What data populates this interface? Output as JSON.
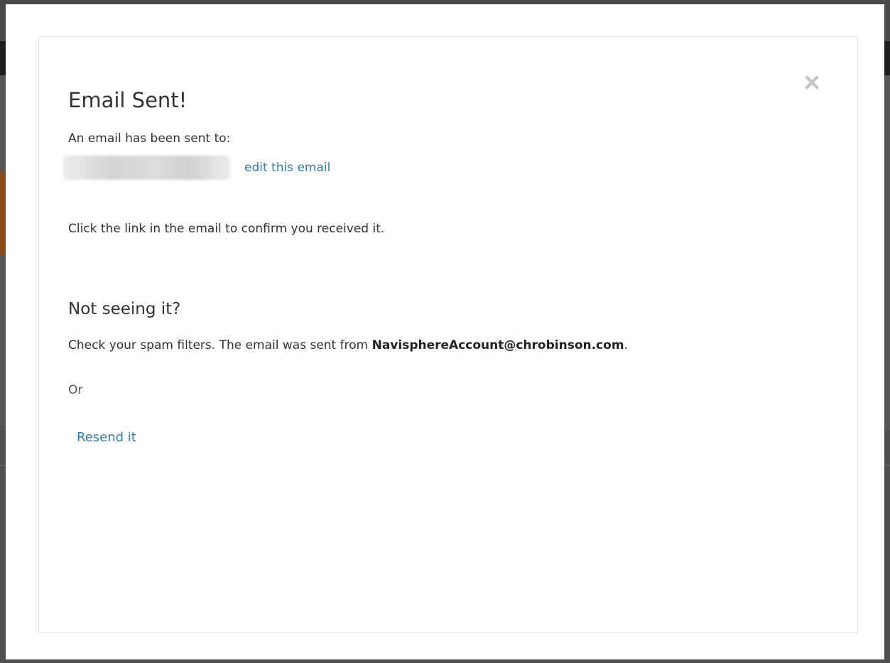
{
  "modal": {
    "title": "Email Sent!",
    "sent_to_label": "An email has been sent to:",
    "recipient_email_redacted": true,
    "edit_email_link": "edit this email",
    "instruction": "Click the link in the email to confirm you received it.",
    "not_seeing_heading": "Not seeing it?",
    "spam_prefix": "Check your spam filters. The email was sent from ",
    "sender_email": "NavisphereAccount@chrobinson.com",
    "spam_suffix": ".",
    "or_text": "Or",
    "resend_link": "Resend it",
    "close_icon": "close-icon"
  },
  "colors": {
    "link": "#2e7fae",
    "text": "#333333",
    "overlay": "#4a4a4a",
    "close_icon": "#c4c4c4"
  }
}
